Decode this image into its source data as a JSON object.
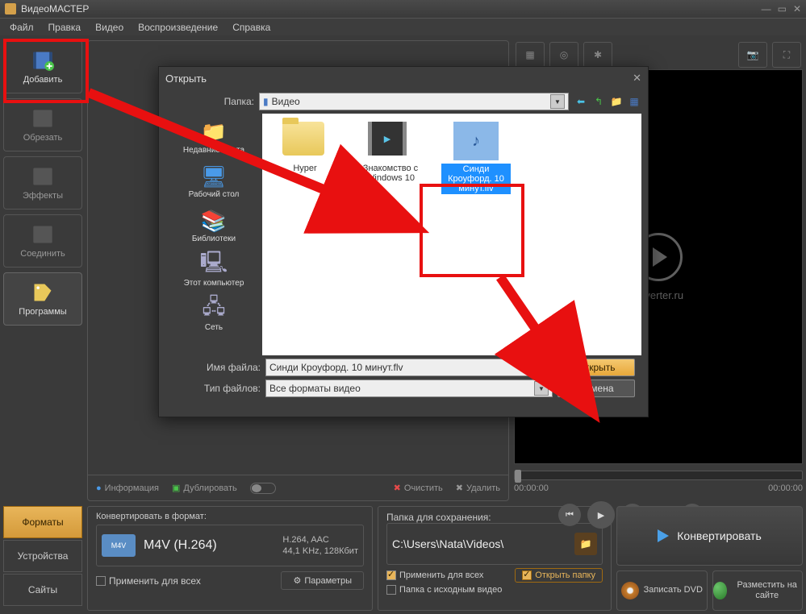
{
  "app": {
    "title": "ВидеоМАСТЕР"
  },
  "menu": {
    "file": "Файл",
    "edit": "Правка",
    "video": "Видео",
    "playback": "Воспроизведение",
    "help": "Справка"
  },
  "sidebar": [
    {
      "label": "Добавить",
      "key": "add"
    },
    {
      "label": "Обрезать",
      "key": "cut"
    },
    {
      "label": "Эффекты",
      "key": "effects"
    },
    {
      "label": "Соединить",
      "key": "join"
    },
    {
      "label": "Программы",
      "key": "programs"
    }
  ],
  "content_toolbar": {
    "info": "Информация",
    "duplicate": "Дублировать",
    "clear": "Очистить",
    "delete": "Удалить"
  },
  "preview": {
    "url": "onverter.ru",
    "time_start": "00:00:00",
    "time_end": "00:00:00"
  },
  "bottom": {
    "tabs": {
      "formats": "Форматы",
      "devices": "Устройства",
      "sites": "Сайты"
    },
    "format": {
      "header": "Конвертировать в формат:",
      "badge": "M4V",
      "name": "M4V (H.264)",
      "line1": "H.264, AAC",
      "line2": "44,1 KHz, 128Кбит",
      "apply_all": "Применить для всех",
      "params": "Параметры"
    },
    "folder": {
      "header": "Папка для сохранения:",
      "path": "C:\\Users\\Nata\\Videos\\",
      "apply_all": "Применить для всех",
      "source_folder": "Папка с исходным видео",
      "open_folder": "Открыть папку"
    },
    "convert": "Конвертировать",
    "burn_dvd": "Записать DVD",
    "publish": "Разместить на сайте"
  },
  "dialog": {
    "title": "Открыть",
    "folder_label": "Папка:",
    "folder_value": "Видео",
    "places": [
      {
        "label": "Недавние места"
      },
      {
        "label": "Рабочий стол"
      },
      {
        "label": "Библиотеки"
      },
      {
        "label": "Этот компьютер"
      },
      {
        "label": "Сеть"
      }
    ],
    "files": [
      {
        "name": "Hyper",
        "type": "folder"
      },
      {
        "name": "Знакомство с Windows 10",
        "type": "video"
      },
      {
        "name": "Синди Кроуфорд. 10 минут.flv",
        "type": "video_sel"
      }
    ],
    "filename_label": "Имя файла:",
    "filename_value": "Синди Кроуфорд. 10 минут.flv",
    "filetype_label": "Тип файлов:",
    "filetype_value": "Все форматы видео",
    "open_btn": "Открыть",
    "cancel_btn": "Отмена"
  }
}
